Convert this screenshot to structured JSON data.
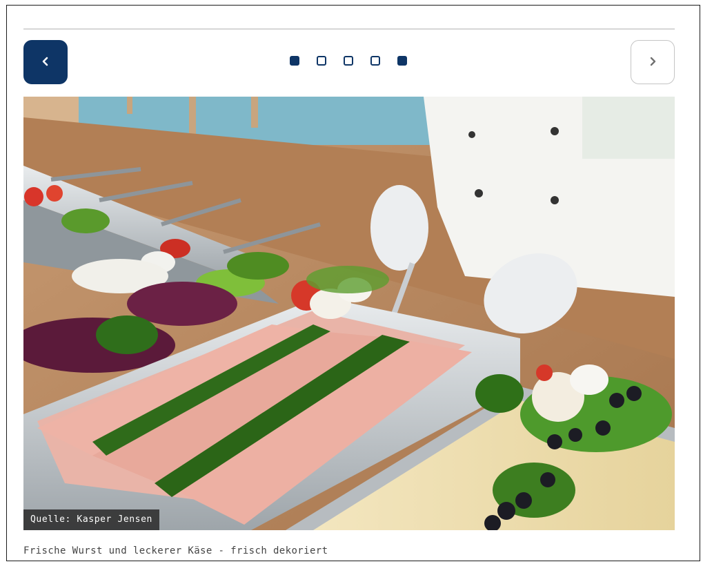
{
  "gallery": {
    "prev_icon": "chevron-left-icon",
    "next_icon": "chevron-right-icon",
    "slide_count": 5,
    "active_slides": [
      1,
      5
    ],
    "colors": {
      "accent": "#0e3566",
      "border": "#c4c4c4",
      "divider": "#d6d6d6",
      "caption_text": "#444444",
      "credit_bg": "#2d2d2d"
    }
  },
  "image": {
    "credit": "Quelle: Kasper Jensen",
    "caption": "Frische Wurst und leckerer Käse - frisch dekoriert"
  }
}
